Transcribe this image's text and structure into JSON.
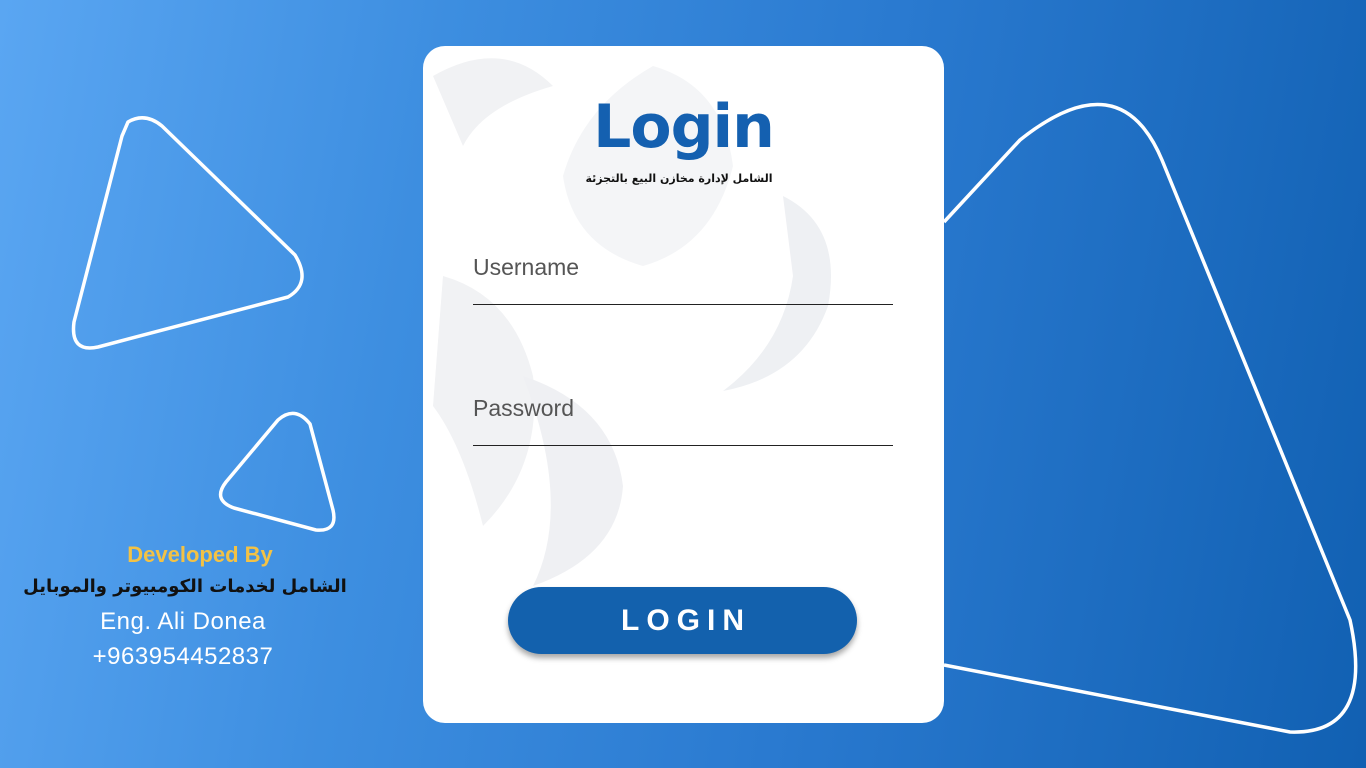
{
  "login": {
    "title": "Login",
    "subtitle": "الشامل لإدارة مخازن البيع بالتجزئة",
    "username_placeholder": "Username",
    "password_placeholder": "Password",
    "button_label": "LOGIN"
  },
  "developer": {
    "label": "Developed By",
    "company": "الشامل لخدمات الكومبيوتر والموبايل",
    "engineer": "Eng. Ali Donea",
    "phone": "+963954452837"
  },
  "colors": {
    "accent": "#1361ad",
    "title": "#1460b0",
    "developed_by": "#f3c245",
    "background_start": "#5aa6f2",
    "background_end": "#1160b2"
  }
}
